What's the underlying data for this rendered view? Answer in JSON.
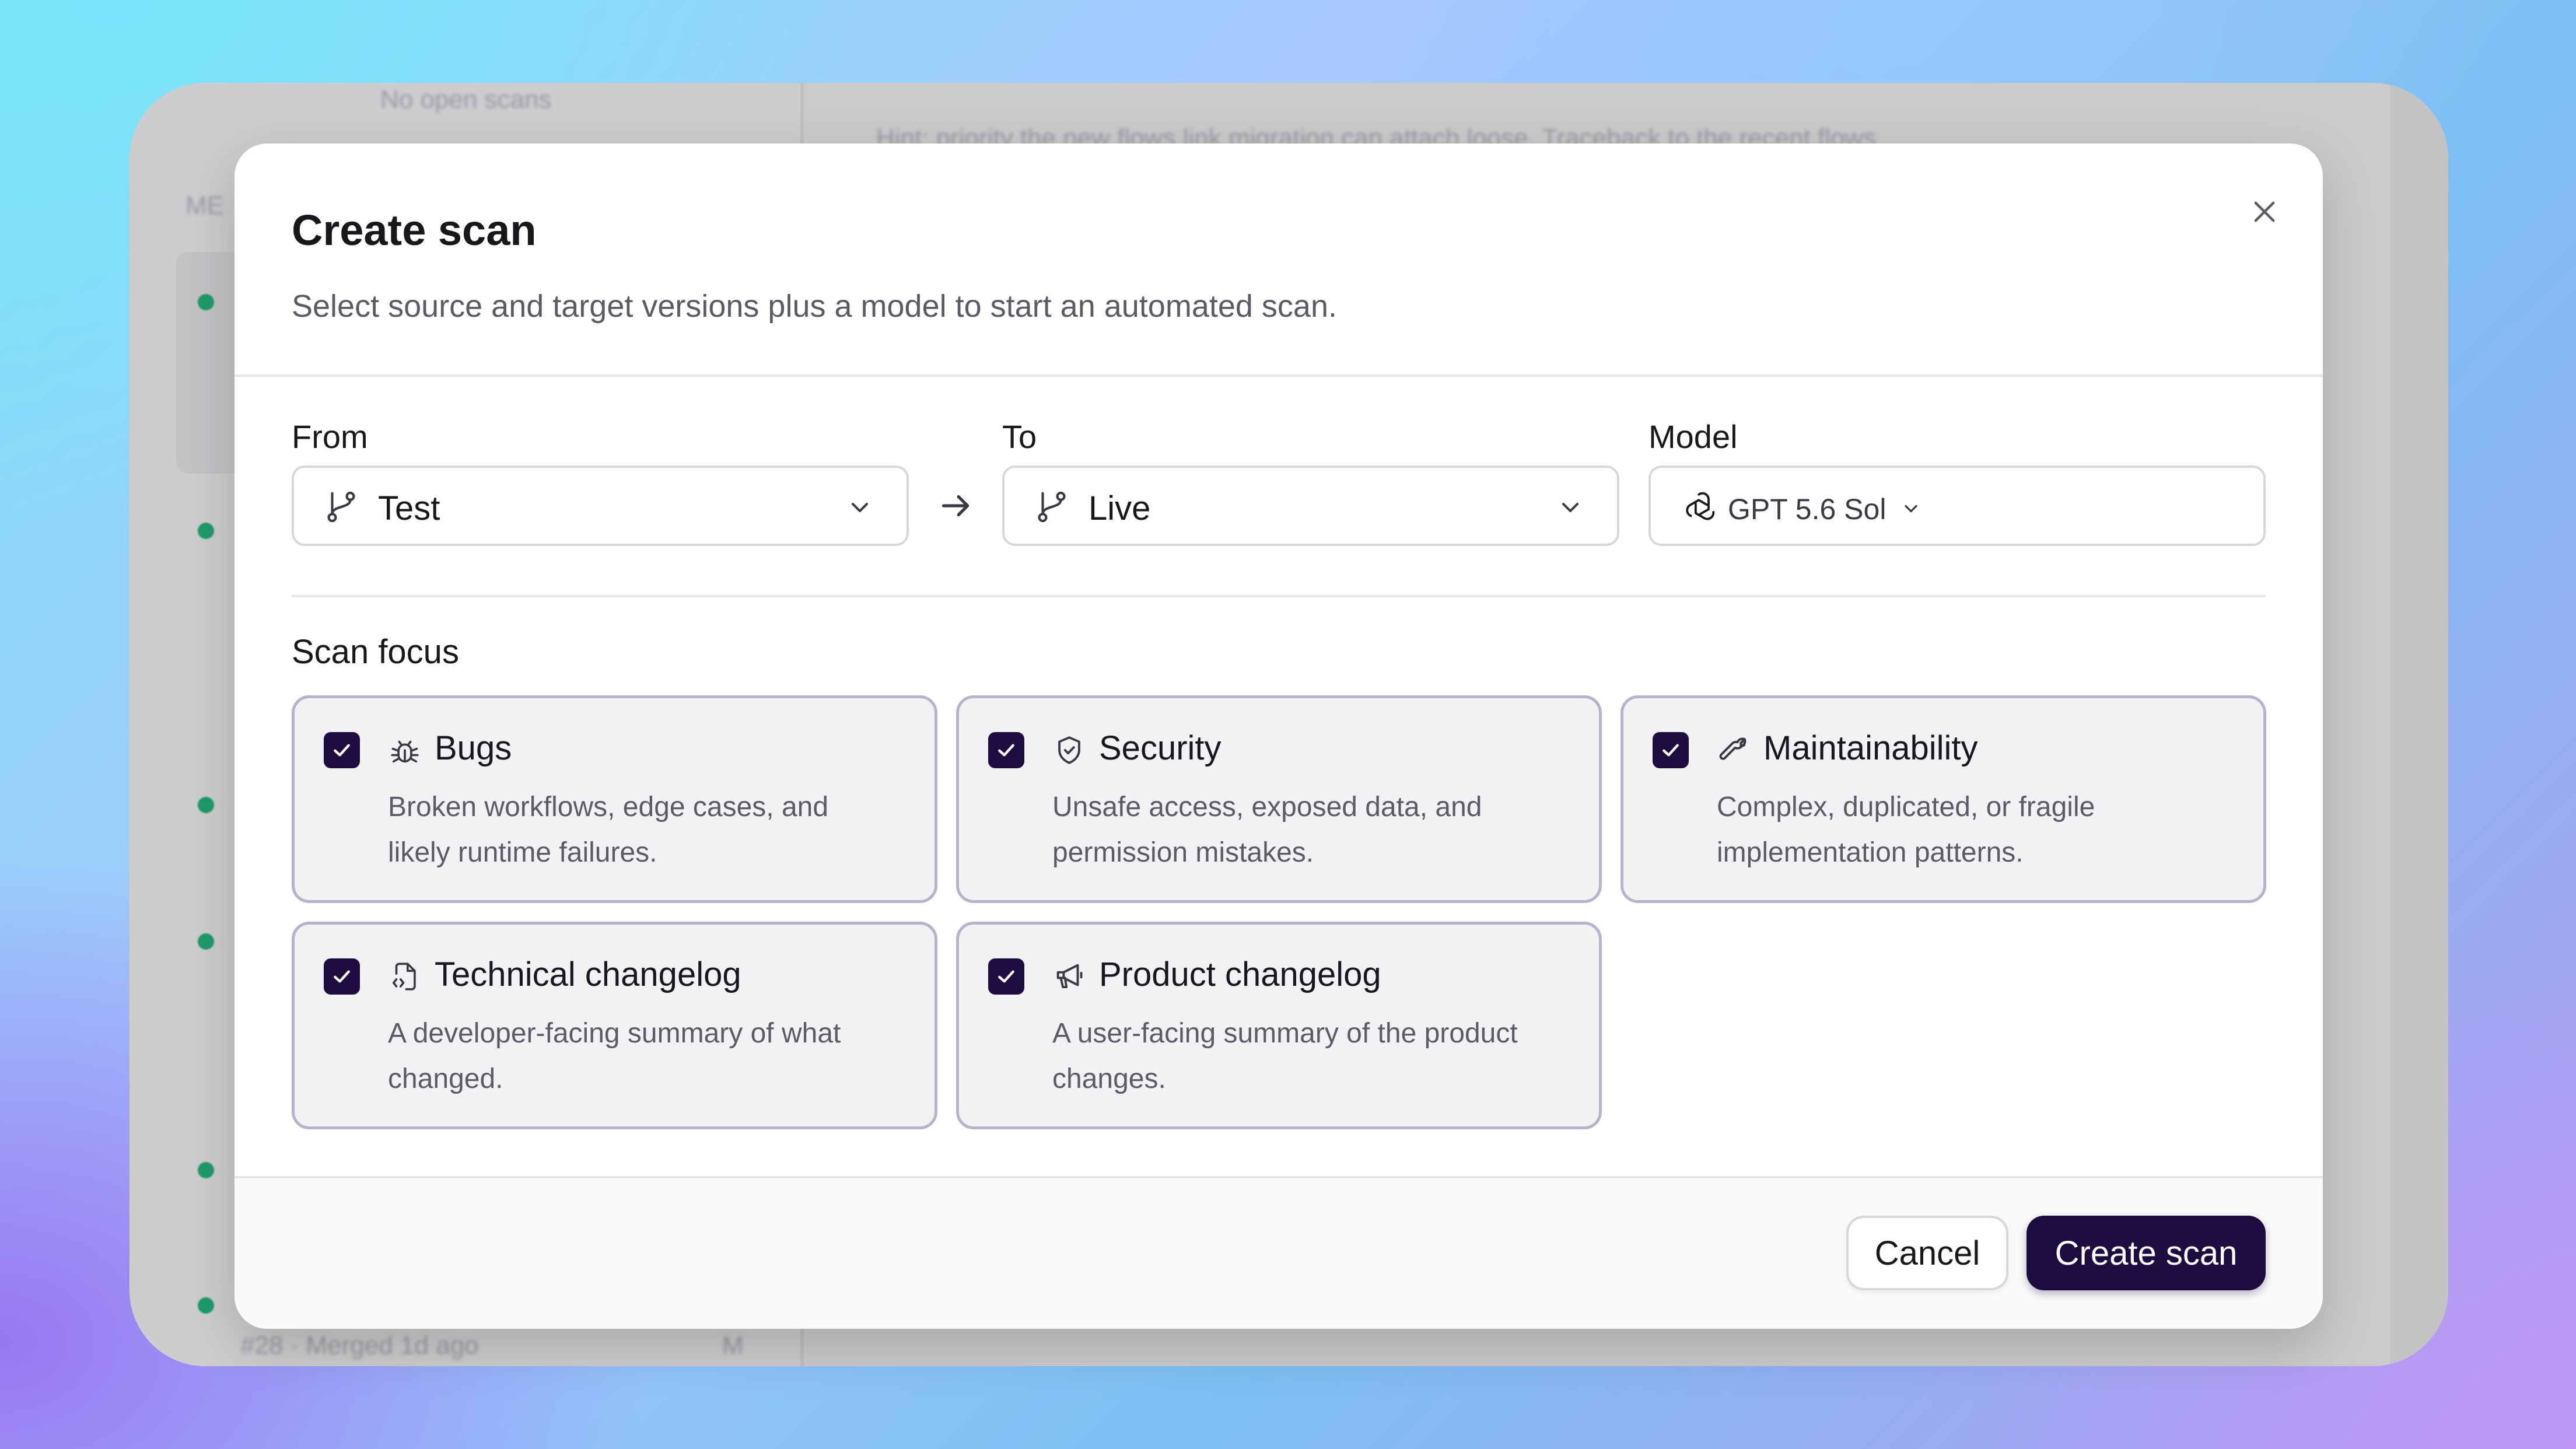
{
  "background": {
    "sidebar_top_text": "No open scans",
    "sidebar_section_text": "ME",
    "main_top_text": "Hint: priority the new flows link migration can attach loose. Traceback to the recent flows",
    "sidebar_bottom_text": "#28 · Merged 1d ago",
    "sidebar_bottom_badge": "M"
  },
  "modal": {
    "title": "Create scan",
    "subtitle": "Select source and target versions plus a model to start an automated scan.",
    "close_icon": "close-icon",
    "from": {
      "label": "From",
      "value": "Test",
      "icon": "git-branch-icon"
    },
    "to": {
      "label": "To",
      "value": "Live",
      "icon": "git-branch-icon"
    },
    "arrow_icon": "arrow-right-icon",
    "model": {
      "label": "Model",
      "value": "GPT 5.6 Sol",
      "icon": "openai-logo-icon"
    },
    "scan_focus": {
      "title": "Scan focus",
      "options": [
        {
          "title": "Bugs",
          "description": "Broken workflows, edge cases, and likely runtime failures.",
          "checked": true,
          "icon": "bug-icon"
        },
        {
          "title": "Security",
          "description": "Unsafe access, exposed data, and permission mistakes.",
          "checked": true,
          "icon": "shield-check-icon"
        },
        {
          "title": "Maintainability",
          "description": "Complex, duplicated, or fragile implementation patterns.",
          "checked": true,
          "icon": "wrench-icon"
        },
        {
          "title": "Technical changelog",
          "description": "A developer-facing summary of what changed.",
          "checked": true,
          "icon": "file-code-icon"
        },
        {
          "title": "Product changelog",
          "description": "A user-facing summary of the product changes.",
          "checked": true,
          "icon": "megaphone-icon"
        }
      ]
    },
    "footer": {
      "cancel_label": "Cancel",
      "create_label": "Create scan"
    }
  },
  "colors": {
    "accent": "#1c0c3f",
    "card_border": "#b8b3cc",
    "card_bg": "#f2f2f5",
    "status_dot": "#1e9a6a"
  }
}
